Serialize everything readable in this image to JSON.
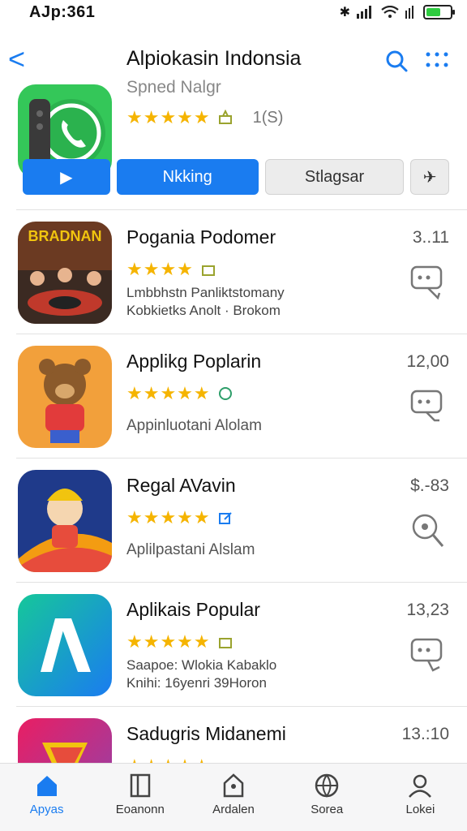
{
  "status_bar": {
    "time": "AJp:361",
    "signal_text": "✱ ▍▎▏"
  },
  "header": {
    "back": "<",
    "title": "Alpiokasin Indonsia",
    "subtitle": "Spned Nalgr",
    "stars": "★★★★★",
    "rating_count": "1(S)"
  },
  "actions": {
    "play_label": "▶",
    "primary_label": "Nkking",
    "secondary_label": "Stlagsar",
    "pin_label": "✈"
  },
  "apps": [
    {
      "title": "Pogania Podomer",
      "stars": "★★★★",
      "line1": "Lmbbhstn Panliktstomany",
      "line2": "Kobkietks Anolt · Brokom",
      "price": "3..11",
      "icon_text": "BRADNAN"
    },
    {
      "title": "Applikg Poplarin",
      "stars": "★★★★★",
      "line1": "Appinluotani  Alolam",
      "line2": "",
      "price": "12,00",
      "icon_text": ""
    },
    {
      "title": "Regal AVavin",
      "stars": "★★★★★",
      "line1": "Aplilpastani  Alslam",
      "line2": "",
      "price": "$.-83",
      "icon_text": ""
    },
    {
      "title": "Aplikais Popular",
      "stars": "★★★★★",
      "line1": "Saapoe: Wlokia Kabaklo",
      "line2": "Knihi: 16yenri  39Horon",
      "price": "13,23",
      "icon_text": ""
    },
    {
      "title": "Sadugris Midanemi",
      "stars": "★★★★★",
      "line1": "",
      "line2": "",
      "price": "13.:10",
      "icon_text": ""
    }
  ],
  "tabs": [
    {
      "label": "Apyas"
    },
    {
      "label": "Eoanonn"
    },
    {
      "label": "Ardalen"
    },
    {
      "label": "Sorea"
    },
    {
      "label": "Lokei"
    }
  ],
  "colors": {
    "accent": "#1a7cf0",
    "star": "#f5b400",
    "battery": "#2ecc40"
  }
}
